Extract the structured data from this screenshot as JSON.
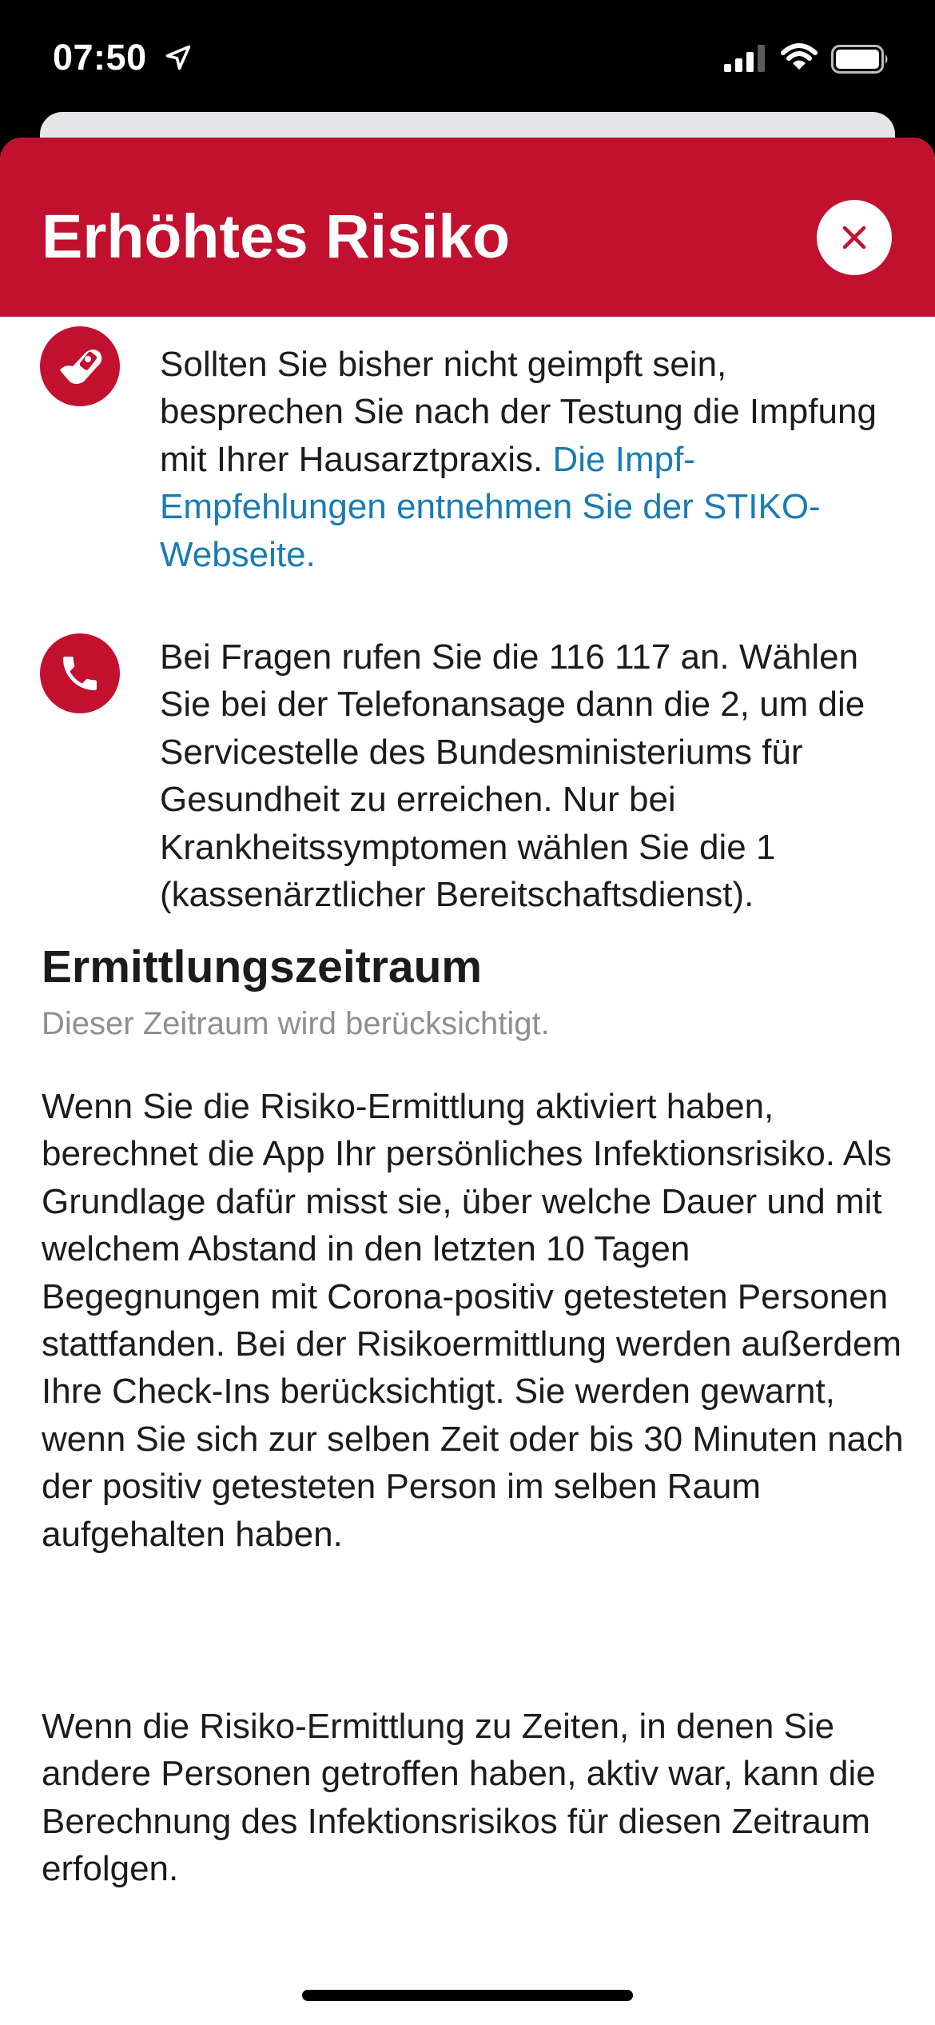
{
  "status_bar": {
    "time": "07:50",
    "icons": [
      "location-arrow-icon",
      "cellular-signal-icon",
      "wifi-icon",
      "battery-icon"
    ]
  },
  "header": {
    "title": "Erhöhtes Risiko",
    "close_icon": "close-icon",
    "color": "#c1112f"
  },
  "rows": [
    {
      "icon": "vaccination-icon",
      "text": "Sollten Sie bisher nicht geimpft sein, besprechen Sie nach der Testung die Impfung mit Ihrer Hausarztpraxis. ",
      "link": "Die Impf-Empfehlungen entnehmen Sie der STIKO-Webseite."
    },
    {
      "icon": "phone-icon",
      "text": "Bei Fragen rufen Sie die 116 117 an. Wählen Sie bei der Telefonansage dann die 2, um die Servicestelle des Bundesministeriums für Gesundheit zu erreichen. Nur bei Krankheitssymptomen wählen Sie die 1 (kassenärztlicher Bereitschaftsdienst)."
    }
  ],
  "section": {
    "title": "Ermittlungszeitraum",
    "subtitle": "Dieser Zeitraum wird berücksichtigt.",
    "paragraphs": [
      "Wenn Sie die Risiko-Ermittlung aktiviert haben, berechnet die App Ihr persönliches Infektionsrisiko. Als Grundlage dafür misst sie, über welche Dauer und mit welchem Abstand in den letzten 10 Tagen Begegnungen mit Corona-positiv getesteten Personen stattfanden. Bei der Risikoermittlung werden außerdem Ihre Check-Ins berücksichtigt. Sie werden gewarnt, wenn Sie sich zur selben Zeit oder bis 30 Minuten nach der positiv getesteten Person im selben Raum aufgehalten haben.",
      "Wenn die Risiko-Ermittlung zu Zeiten, in denen Sie andere Personen getroffen haben, aktiv war, kann die Berechnung des Infektionsrisikos für diesen Zeitraum erfolgen."
    ]
  },
  "colors": {
    "accent": "#c1112f",
    "link": "#1a7bb5"
  }
}
